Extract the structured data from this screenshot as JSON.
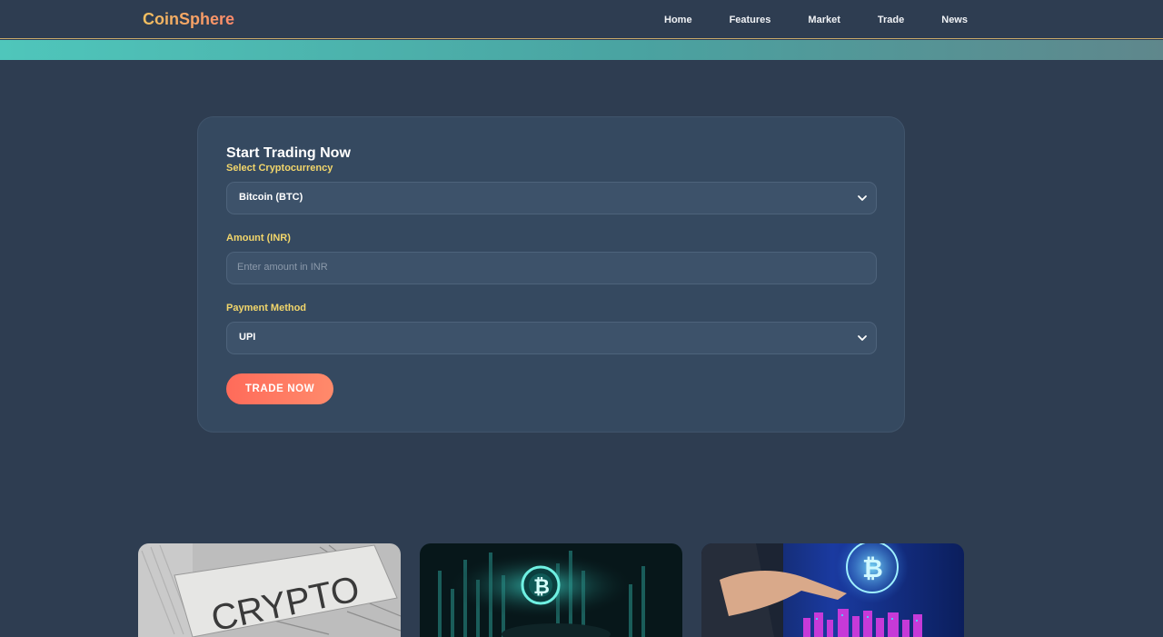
{
  "header": {
    "logo": "CoinSphere",
    "nav": [
      {
        "label": "Home"
      },
      {
        "label": "Features"
      },
      {
        "label": "Market"
      },
      {
        "label": "Trade"
      },
      {
        "label": "News"
      }
    ]
  },
  "trade_form": {
    "title": "Start Trading Now",
    "crypto_label": "Select Cryptocurrency",
    "crypto_value": "Bitcoin (BTC)",
    "amount_label": "Amount (INR)",
    "amount_placeholder": "Enter amount in INR",
    "amount_value": "",
    "payment_label": "Payment Method",
    "payment_value": "UPI",
    "submit_label": "TRADE NOW"
  },
  "tiles": {
    "newspaper_text": "CRYPTO"
  },
  "colors": {
    "background": "#2e3d51",
    "card": "#354960",
    "label": "#f2d66b",
    "accent_teal": "#4fc6bb",
    "button": "#ff6b5a"
  },
  "icons": {
    "dropdown": "chevron-down-icon",
    "coin": "bitcoin-icon"
  }
}
